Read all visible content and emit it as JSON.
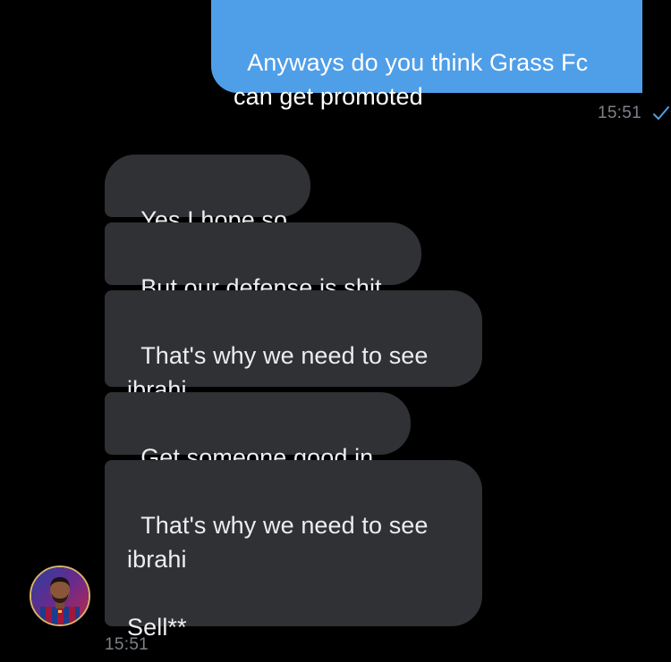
{
  "outgoing": {
    "text": "Anyways do you think Grass Fc\ncan get promoted",
    "time": "15:51",
    "status_icon": "check-icon"
  },
  "incoming": {
    "messages": [
      {
        "text": "Yes I hope so"
      },
      {
        "text": "But our defense is shit"
      },
      {
        "text": "That's why we need to see\nibrahi"
      },
      {
        "text": "Get someone good in"
      },
      {
        "text": "That's why we need to see\nibrahi\n\nSell**"
      }
    ],
    "time": "15:51",
    "avatar_icon": "contact-avatar"
  },
  "colors": {
    "background": "#000000",
    "sent_bubble": "#4f9ee8",
    "received_bubble": "#2f3134",
    "timestamp": "#7d8188",
    "check": "#4f9ee8"
  }
}
